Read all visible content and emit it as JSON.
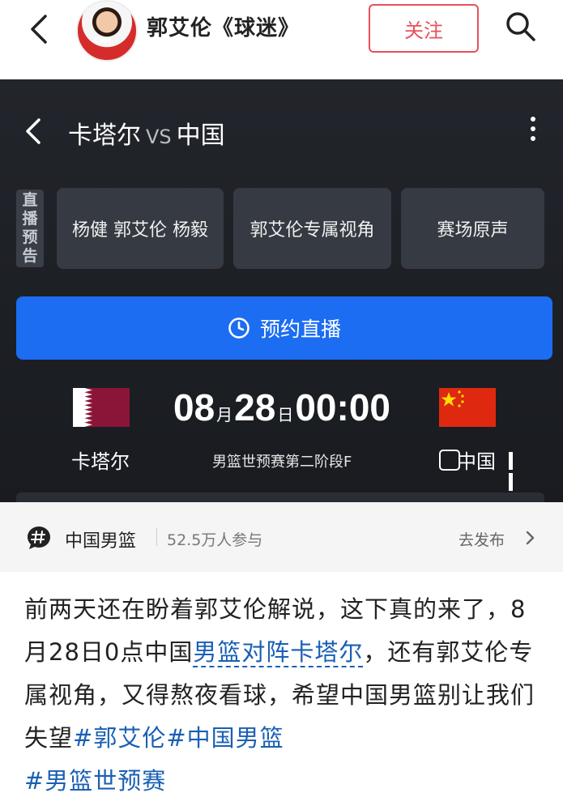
{
  "header": {
    "user_name": "郭艾伦《球迷》",
    "follow_label": "关注"
  },
  "card": {
    "team_home": "卡塔尔",
    "vs_label": "VS",
    "team_away": "中国",
    "live_tag": "直播预告",
    "options": [
      "杨健 郭艾伦 杨毅",
      "郭艾伦专属视角",
      "赛场原声"
    ],
    "reserve_label": "预约直播",
    "time": {
      "month": "08",
      "month_unit": "月",
      "day": "28",
      "day_unit": "日",
      "clock": "00:00"
    },
    "league": "男篮世预赛第二阶段F",
    "colors": {
      "reserve_button": "#1c6df2",
      "qatar_flag": "#8a1538",
      "china_flag": "#de2910"
    }
  },
  "topic": {
    "name": "中国男篮",
    "count": "52.5万人参与",
    "publish_label": "去发布"
  },
  "post": {
    "text_1": "前两天还在盼着郭艾伦解说，这下真的来了，8月28日0点中国",
    "link_1": "男篮对阵卡塔尔",
    "text_2": "，还有郭艾伦专属视角，又得熬夜看球，希望中国男篮别让我们失望",
    "tag_1": "#郭艾伦",
    "tag_2": "#中国男篮",
    "tag_3": "#男篮世预赛"
  }
}
